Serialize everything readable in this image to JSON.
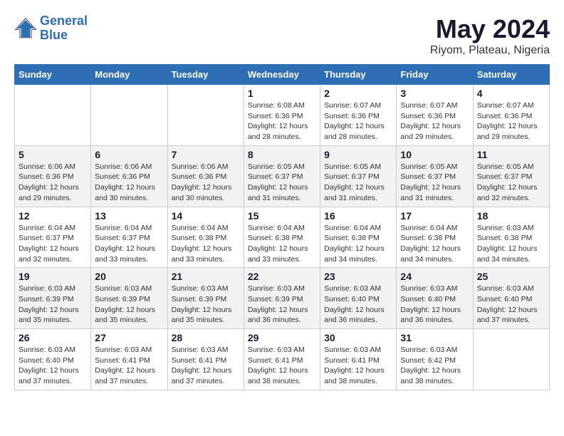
{
  "logo": {
    "line1": "General",
    "line2": "Blue"
  },
  "title": "May 2024",
  "subtitle": "Riyom, Plateau, Nigeria",
  "days_header": [
    "Sunday",
    "Monday",
    "Tuesday",
    "Wednesday",
    "Thursday",
    "Friday",
    "Saturday"
  ],
  "weeks": [
    [
      {
        "day": "",
        "info": ""
      },
      {
        "day": "",
        "info": ""
      },
      {
        "day": "",
        "info": ""
      },
      {
        "day": "1",
        "info": "Sunrise: 6:08 AM\nSunset: 6:36 PM\nDaylight: 12 hours\nand 28 minutes."
      },
      {
        "day": "2",
        "info": "Sunrise: 6:07 AM\nSunset: 6:36 PM\nDaylight: 12 hours\nand 28 minutes."
      },
      {
        "day": "3",
        "info": "Sunrise: 6:07 AM\nSunset: 6:36 PM\nDaylight: 12 hours\nand 29 minutes."
      },
      {
        "day": "4",
        "info": "Sunrise: 6:07 AM\nSunset: 6:36 PM\nDaylight: 12 hours\nand 29 minutes."
      }
    ],
    [
      {
        "day": "5",
        "info": "Sunrise: 6:06 AM\nSunset: 6:36 PM\nDaylight: 12 hours\nand 29 minutes."
      },
      {
        "day": "6",
        "info": "Sunrise: 6:06 AM\nSunset: 6:36 PM\nDaylight: 12 hours\nand 30 minutes."
      },
      {
        "day": "7",
        "info": "Sunrise: 6:06 AM\nSunset: 6:36 PM\nDaylight: 12 hours\nand 30 minutes."
      },
      {
        "day": "8",
        "info": "Sunrise: 6:05 AM\nSunset: 6:37 PM\nDaylight: 12 hours\nand 31 minutes."
      },
      {
        "day": "9",
        "info": "Sunrise: 6:05 AM\nSunset: 6:37 PM\nDaylight: 12 hours\nand 31 minutes."
      },
      {
        "day": "10",
        "info": "Sunrise: 6:05 AM\nSunset: 6:37 PM\nDaylight: 12 hours\nand 31 minutes."
      },
      {
        "day": "11",
        "info": "Sunrise: 6:05 AM\nSunset: 6:37 PM\nDaylight: 12 hours\nand 32 minutes."
      }
    ],
    [
      {
        "day": "12",
        "info": "Sunrise: 6:04 AM\nSunset: 6:37 PM\nDaylight: 12 hours\nand 32 minutes."
      },
      {
        "day": "13",
        "info": "Sunrise: 6:04 AM\nSunset: 6:37 PM\nDaylight: 12 hours\nand 33 minutes."
      },
      {
        "day": "14",
        "info": "Sunrise: 6:04 AM\nSunset: 6:38 PM\nDaylight: 12 hours\nand 33 minutes."
      },
      {
        "day": "15",
        "info": "Sunrise: 6:04 AM\nSunset: 6:38 PM\nDaylight: 12 hours\nand 33 minutes."
      },
      {
        "day": "16",
        "info": "Sunrise: 6:04 AM\nSunset: 6:38 PM\nDaylight: 12 hours\nand 34 minutes."
      },
      {
        "day": "17",
        "info": "Sunrise: 6:04 AM\nSunset: 6:38 PM\nDaylight: 12 hours\nand 34 minutes."
      },
      {
        "day": "18",
        "info": "Sunrise: 6:03 AM\nSunset: 6:38 PM\nDaylight: 12 hours\nand 34 minutes."
      }
    ],
    [
      {
        "day": "19",
        "info": "Sunrise: 6:03 AM\nSunset: 6:39 PM\nDaylight: 12 hours\nand 35 minutes."
      },
      {
        "day": "20",
        "info": "Sunrise: 6:03 AM\nSunset: 6:39 PM\nDaylight: 12 hours\nand 35 minutes."
      },
      {
        "day": "21",
        "info": "Sunrise: 6:03 AM\nSunset: 6:39 PM\nDaylight: 12 hours\nand 35 minutes."
      },
      {
        "day": "22",
        "info": "Sunrise: 6:03 AM\nSunset: 6:39 PM\nDaylight: 12 hours\nand 36 minutes."
      },
      {
        "day": "23",
        "info": "Sunrise: 6:03 AM\nSunset: 6:40 PM\nDaylight: 12 hours\nand 36 minutes."
      },
      {
        "day": "24",
        "info": "Sunrise: 6:03 AM\nSunset: 6:40 PM\nDaylight: 12 hours\nand 36 minutes."
      },
      {
        "day": "25",
        "info": "Sunrise: 6:03 AM\nSunset: 6:40 PM\nDaylight: 12 hours\nand 37 minutes."
      }
    ],
    [
      {
        "day": "26",
        "info": "Sunrise: 6:03 AM\nSunset: 6:40 PM\nDaylight: 12 hours\nand 37 minutes."
      },
      {
        "day": "27",
        "info": "Sunrise: 6:03 AM\nSunset: 6:41 PM\nDaylight: 12 hours\nand 37 minutes."
      },
      {
        "day": "28",
        "info": "Sunrise: 6:03 AM\nSunset: 6:41 PM\nDaylight: 12 hours\nand 37 minutes."
      },
      {
        "day": "29",
        "info": "Sunrise: 6:03 AM\nSunset: 6:41 PM\nDaylight: 12 hours\nand 38 minutes."
      },
      {
        "day": "30",
        "info": "Sunrise: 6:03 AM\nSunset: 6:41 PM\nDaylight: 12 hours\nand 38 minutes."
      },
      {
        "day": "31",
        "info": "Sunrise: 6:03 AM\nSunset: 6:42 PM\nDaylight: 12 hours\nand 38 minutes."
      },
      {
        "day": "",
        "info": ""
      }
    ]
  ]
}
